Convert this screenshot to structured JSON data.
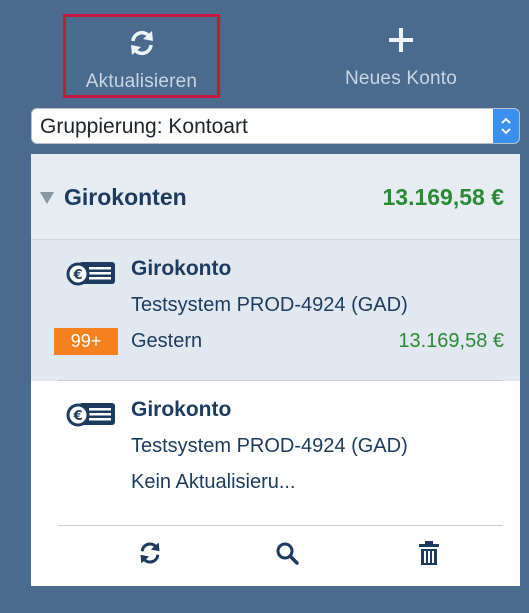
{
  "toolbar": {
    "refresh_label": "Aktualisieren",
    "new_account_label": "Neues Konto"
  },
  "grouping": {
    "selected": "Gruppierung: Kontoart"
  },
  "group": {
    "title": "Girokonten",
    "total": "13.169,58 €"
  },
  "accounts": [
    {
      "name": "Girokonto",
      "bank": "Testsystem PROD-4924 (GAD)",
      "badge": "99+",
      "status": "Gestern",
      "balance": "13.169,58 €"
    },
    {
      "name": "Girokonto",
      "bank": "Testsystem PROD-4924 (GAD)",
      "status": "Kein Aktualisieru..."
    }
  ],
  "actions": [
    "refresh-icon",
    "search-icon",
    "trash-icon"
  ],
  "colors": {
    "sidebar_bg": "#4a6a8e",
    "highlight_border": "#c7173d",
    "amount_green": "#2a8a36",
    "badge_orange": "#f5821f",
    "select_accent": "#3a8fef",
    "text_navy": "#1d3b5e"
  }
}
